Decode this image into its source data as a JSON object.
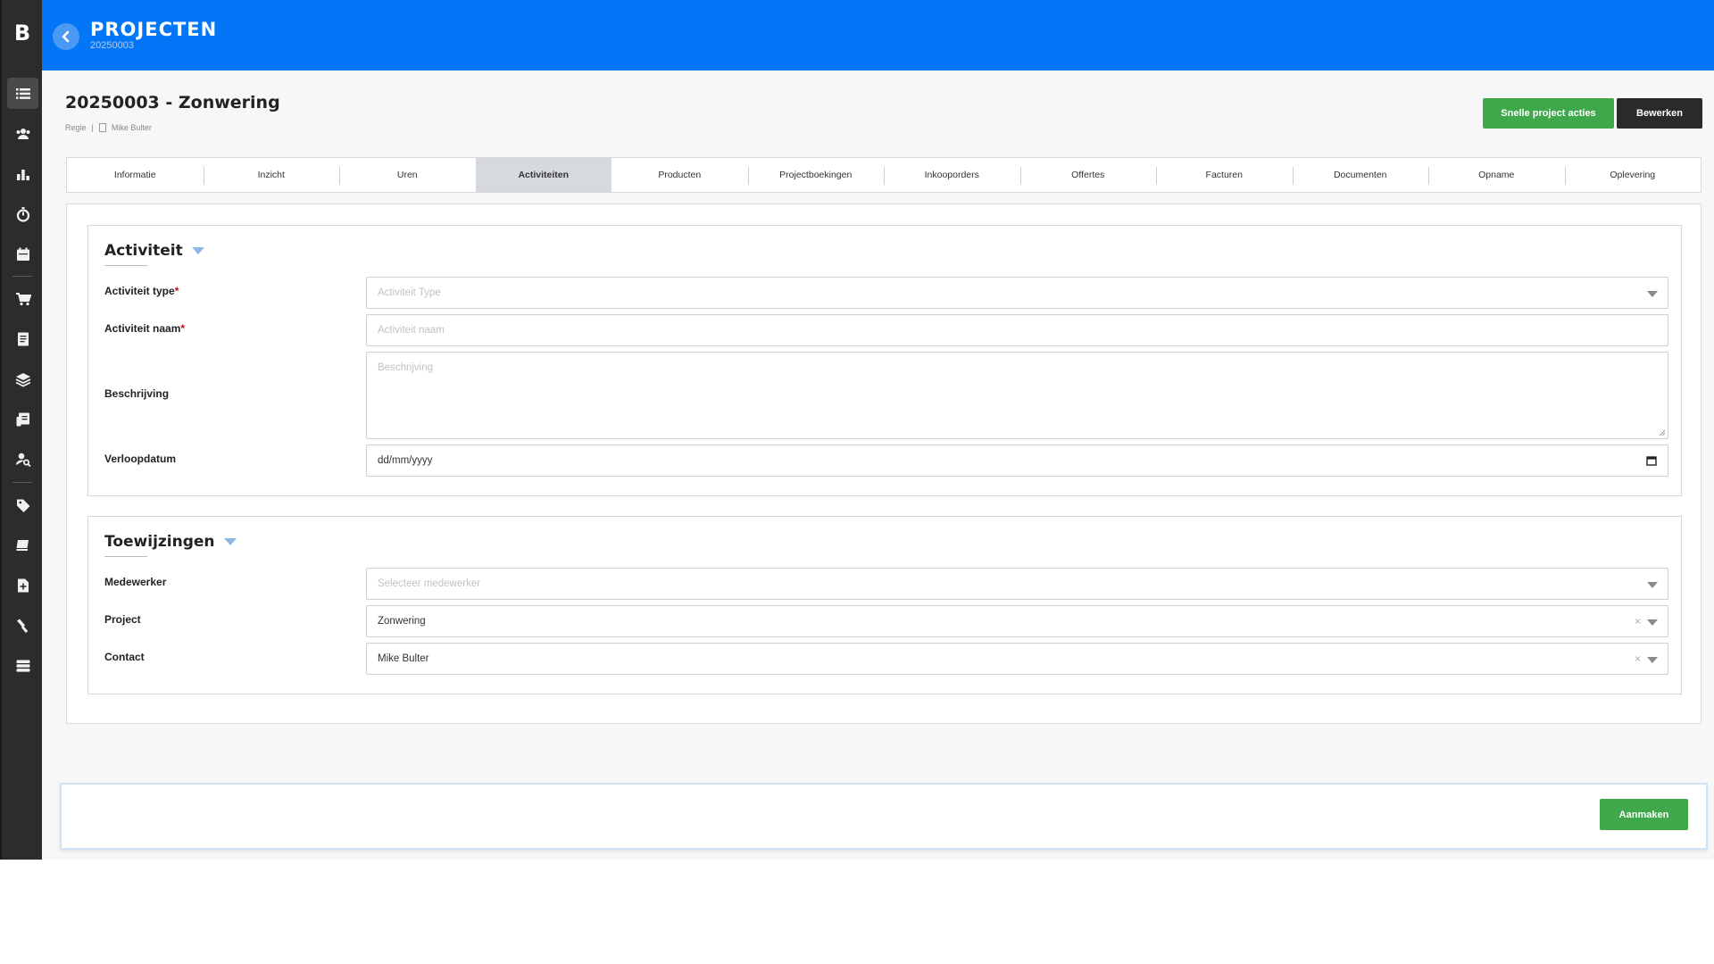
{
  "sidebar": {
    "logo": "B",
    "icons": [
      "list-icon",
      "users-icon",
      "bar-chart-icon",
      "stopwatch-icon",
      "calendar-icon",
      "cart-icon",
      "document-icon",
      "layers-icon",
      "report-icon",
      "user-search-icon",
      "tag-icon",
      "book-icon",
      "file-plus-icon",
      "wrench-icon",
      "stack-icon"
    ]
  },
  "header": {
    "title": "PROJECTEN",
    "subtitle": "20250003"
  },
  "page": {
    "title": "20250003 - Zonwering",
    "type": "Regie",
    "separator": "|",
    "contact": "Mike Bulter"
  },
  "actions": {
    "quick_actions": "Snelle project acties",
    "edit": "Bewerken"
  },
  "tabs": [
    {
      "label": "Informatie"
    },
    {
      "label": "Inzicht"
    },
    {
      "label": "Uren"
    },
    {
      "label": "Activiteiten",
      "active": true
    },
    {
      "label": "Producten"
    },
    {
      "label": "Projectboekingen"
    },
    {
      "label": "Inkooporders"
    },
    {
      "label": "Offertes"
    },
    {
      "label": "Facturen"
    },
    {
      "label": "Documenten"
    },
    {
      "label": "Opname"
    },
    {
      "label": "Oplevering"
    }
  ],
  "activiteit": {
    "title": "Activiteit",
    "type_label": "Activiteit type",
    "type_placeholder": "Activiteit Type",
    "name_label": "Activiteit naam",
    "name_placeholder": "Activiteit naam",
    "description_label": "Beschrijving",
    "description_placeholder": "Beschrijving",
    "due_label": "Verloopdatum",
    "due_value": "dd/mm/yyyy",
    "required_mark": "*"
  },
  "toewijzingen": {
    "title": "Toewijzingen",
    "employee_label": "Medewerker",
    "employee_placeholder": "Selecteer medewerker",
    "project_label": "Project",
    "project_value": "Zonwering",
    "contact_label": "Contact",
    "contact_value": "Mike Bulter",
    "clear_symbol": "×"
  },
  "footer": {
    "create": "Aanmaken"
  },
  "colors": {
    "header": "#0276f7",
    "sidebar": "#2c2c2c",
    "green": "#3fa84a",
    "dark_button": "#2a2a2a",
    "active_tab": "#d6d9de"
  }
}
